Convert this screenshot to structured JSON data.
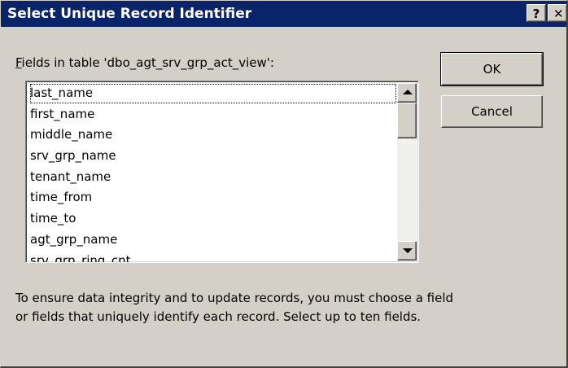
{
  "window": {
    "title": "Select Unique Record Identifier",
    "help_label": "?",
    "close_label": "✕"
  },
  "fields_label": {
    "mnemonic": "F",
    "rest": "ields in table 'dbo_agt_srv_grp_act_view':"
  },
  "fields": [
    "last_name",
    "first_name",
    "middle_name",
    "srv_grp_name",
    "tenant_name",
    "time_from",
    "time_to",
    "agt_grp_name",
    "srv_grp_ring_cnt"
  ],
  "buttons": {
    "ok_label": "OK",
    "cancel_label": "Cancel"
  },
  "info_text": "To ensure data integrity and to update records, you must choose a field or fields that uniquely identify each record. Select up to ten fields."
}
